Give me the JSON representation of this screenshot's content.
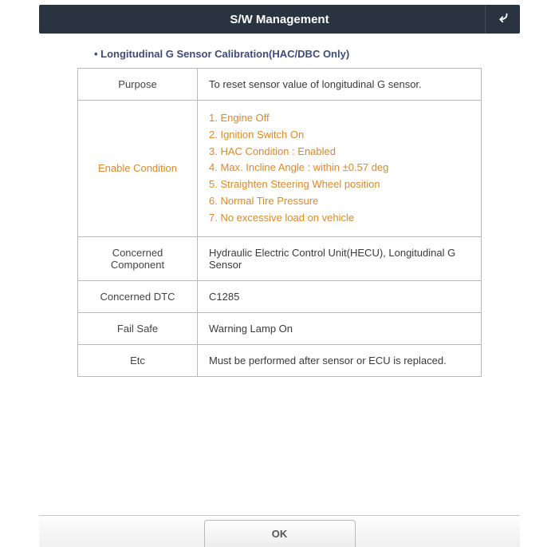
{
  "header": {
    "title": "S/W Management"
  },
  "subtitle": "• Longitudinal G Sensor Calibration(HAC/DBC Only)",
  "rows": {
    "purpose": {
      "label": "Purpose",
      "value": "To reset sensor value of longitudinal G sensor."
    },
    "enable": {
      "label": "Enable Condition",
      "v1": "1. Engine Off",
      "v2": "2. Ignition Switch On",
      "v3": "3. HAC Condition : Enabled",
      "v4": "4. Max. Incline Angle : within ±0.57 deg",
      "v5": "5. Straighten Steering Wheel position",
      "v6": "6. Normal Tire Pressure",
      "v7": "7. No excessive load on vehicle"
    },
    "component": {
      "label": "Concerned Component",
      "value": "Hydraulic Electric Control Unit(HECU), Longitudinal G Sensor"
    },
    "dtc": {
      "label": "Concerned DTC",
      "value": "C1285"
    },
    "failsafe": {
      "label": "Fail Safe",
      "value": "Warning Lamp On"
    },
    "etc": {
      "label": "Etc",
      "value": "Must be performed after sensor or ECU is replaced."
    }
  },
  "footer": {
    "ok": "OK"
  }
}
